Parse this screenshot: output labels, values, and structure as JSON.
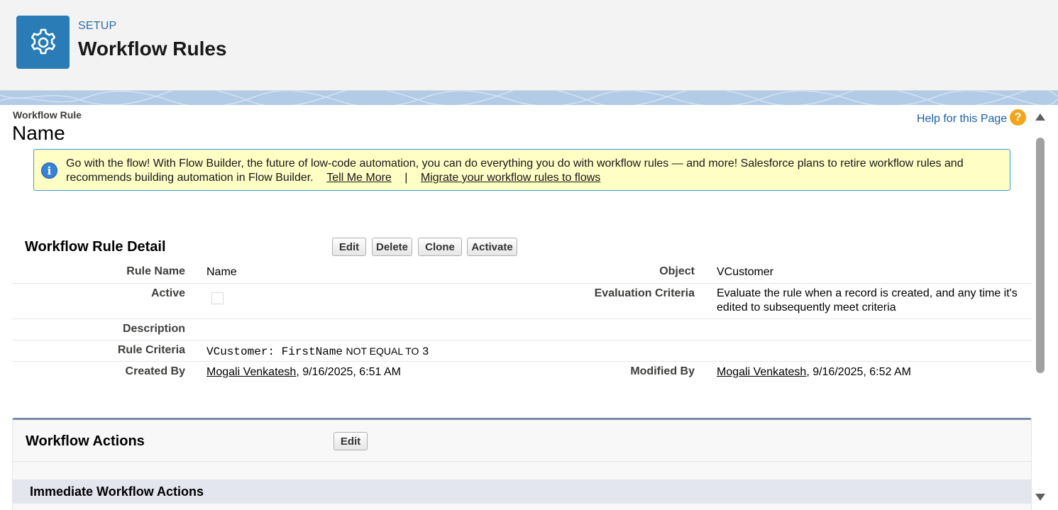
{
  "header": {
    "kicker": "SETUP",
    "title": "Workflow Rules",
    "icon": "gear-icon",
    "icon_color": "#2a7cb6"
  },
  "page": {
    "kicker": "Workflow Rule",
    "title": "Name",
    "help_link": "Help for this Page",
    "help_icon": "?"
  },
  "info": {
    "message": "Go with the flow! With Flow Builder, the future of low-code automation, you can do everything you do with workflow rules — and more! Salesforce plans to retire workflow rules and recommends building automation in Flow Builder.",
    "link_tell_more": "Tell Me More",
    "separator": "|",
    "link_migrate": "Migrate your workflow rules to flows",
    "icon_glyph": "i"
  },
  "detail": {
    "title": "Workflow Rule Detail",
    "buttons": {
      "edit": "Edit",
      "delete": "Delete",
      "clone": "Clone",
      "activate": "Activate"
    },
    "rule_name": {
      "label": "Rule Name",
      "value": "Name"
    },
    "object": {
      "label": "Object",
      "value": "VCustomer"
    },
    "active": {
      "label": "Active",
      "checked": false
    },
    "evaluation": {
      "label": "Evaluation Criteria",
      "value": "Evaluate the rule when a record is created, and any time it's edited to subsequently meet criteria"
    },
    "description": {
      "label": "Description",
      "value": ""
    },
    "criteria": {
      "label": "Rule Criteria",
      "field": "VCustomer: FirstName",
      "operator": "NOT EQUAL TO",
      "value": "3"
    },
    "created_by": {
      "label": "Created By",
      "user": "Mogali Venkatesh",
      "date": ", 9/16/2025, 6:51 AM"
    },
    "modified_by": {
      "label": "Modified By",
      "user": "Mogali Venkatesh",
      "date": ", 9/16/2025, 6:52 AM"
    }
  },
  "actions": {
    "title": "Workflow Actions",
    "edit_button": "Edit",
    "immediate_title": "Immediate Workflow Actions"
  },
  "colors": {
    "accent": "#2a7cb6",
    "link": "#1b5fa8",
    "info_bg": "#fefec5",
    "info_border": "#3b9ce0",
    "help": "#f2a51a",
    "section_border": "#7a8aa6",
    "band": "#b2cbe6"
  }
}
